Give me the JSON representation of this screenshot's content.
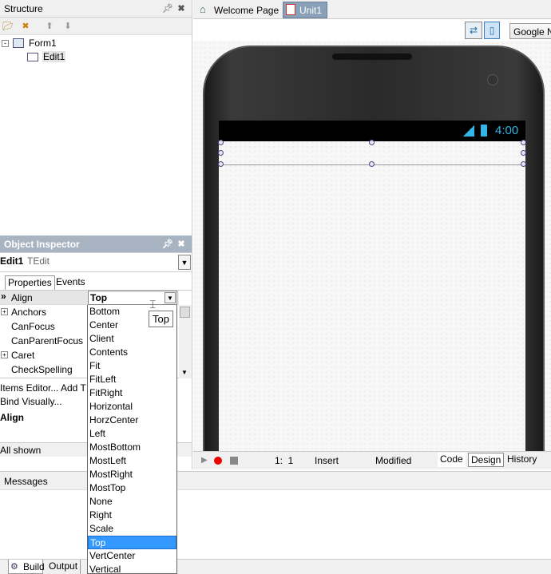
{
  "structure": {
    "title": "Structure",
    "tree": [
      {
        "label": "Form1"
      },
      {
        "label": "Edit1"
      }
    ]
  },
  "tabs": [
    {
      "label": "Welcome Page"
    },
    {
      "label": "Unit1"
    }
  ],
  "toolbar": {
    "device_label": "Google N"
  },
  "device": {
    "time": "4:00"
  },
  "inspector": {
    "title": "Object Inspector",
    "selected_name": "Edit1",
    "selected_type": "TEdit",
    "tab_properties": "Properties",
    "tab_events": "Events",
    "current_property": "Align",
    "current_value": "Top",
    "properties": [
      {
        "name": "Anchors",
        "expandable": true
      },
      {
        "name": "CanFocus",
        "expandable": false
      },
      {
        "name": "CanParentFocus",
        "expandable": false
      },
      {
        "name": "Caret",
        "expandable": true
      },
      {
        "name": "CheckSpelling",
        "expandable": false
      }
    ],
    "link_items_editor": "Items Editor...",
    "link_add": "Add T",
    "link_bind": "Bind Visually...",
    "desc_title": "Align",
    "status": "All shown",
    "tooltip": "Top"
  },
  "dropdown": {
    "options": [
      "Bottom",
      "Center",
      "Client",
      "Contents",
      "Fit",
      "FitLeft",
      "FitRight",
      "Horizontal",
      "HorzCenter",
      "Left",
      "MostBottom",
      "MostLeft",
      "MostRight",
      "MostTop",
      "None",
      "Right",
      "Scale",
      "Top",
      "VertCenter",
      "Vertical"
    ],
    "selected": "Top"
  },
  "editor_status": {
    "position": "1:  1",
    "mode": "Insert",
    "state": "Modified",
    "tab_code": "Code",
    "tab_design": "Design",
    "tab_history": "History"
  },
  "messages": {
    "title": "Messages",
    "tab_build": "Build",
    "tab_output": "Output"
  }
}
